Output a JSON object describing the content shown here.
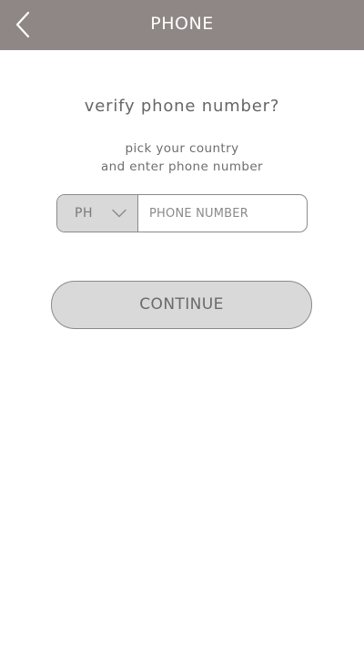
{
  "header": {
    "title": "PHONE",
    "back_icon": "chevron-left-icon",
    "background_color": "#8f8785"
  },
  "main": {
    "question": "verify phone number?",
    "instructions_line1": "pick your country",
    "instructions_line2": "and enter phone number",
    "country_select": {
      "selected_value": "PH",
      "icon": "chevron-down-icon"
    },
    "phone_input": {
      "placeholder": "PHONE NUMBER",
      "value": ""
    },
    "continue_label": "CONTINUE"
  }
}
